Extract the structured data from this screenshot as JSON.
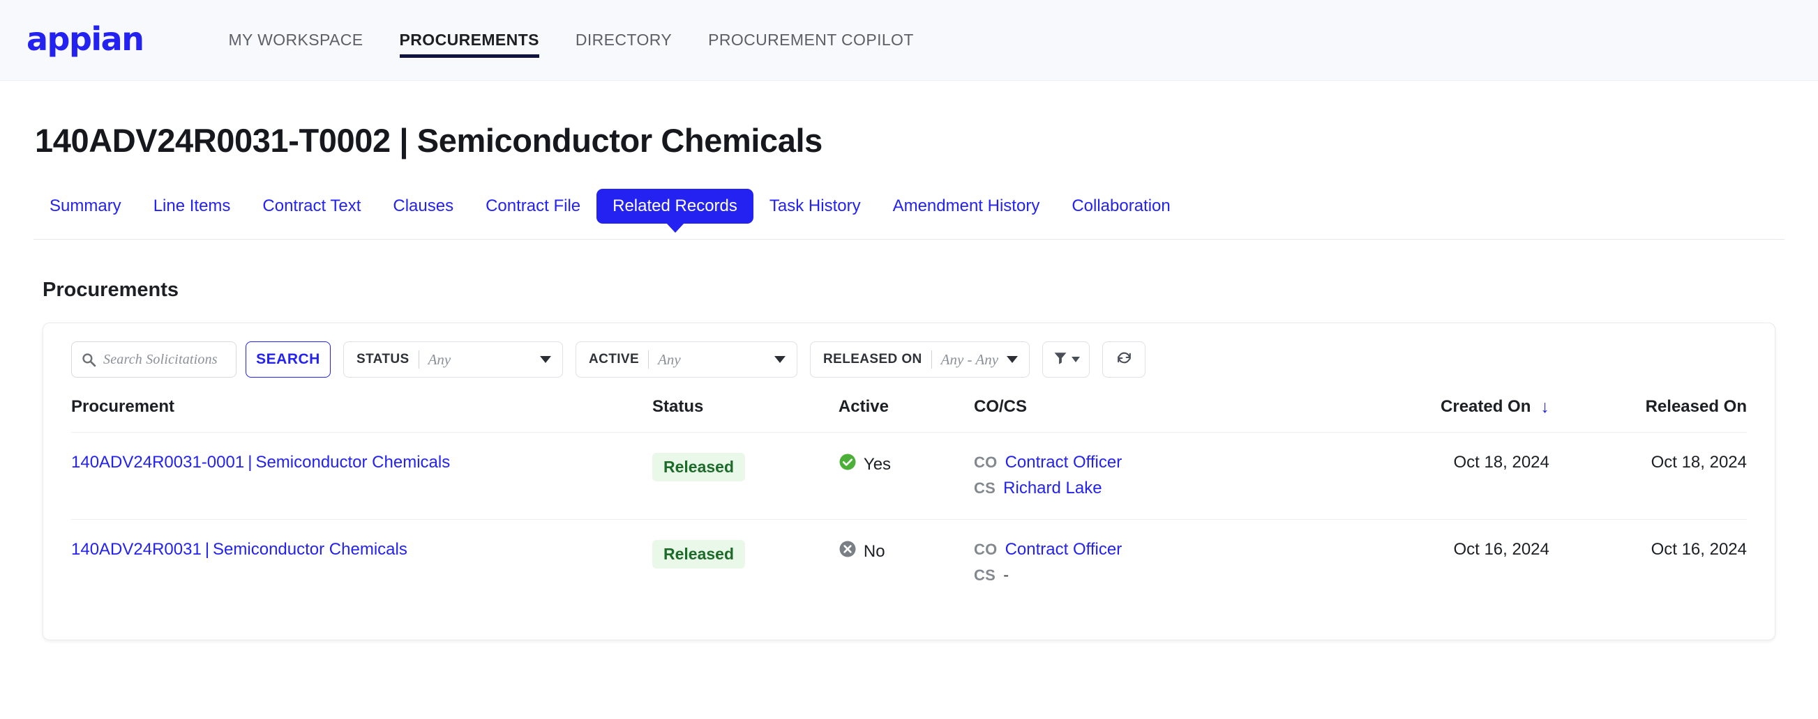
{
  "header": {
    "logo_text": "appian",
    "nav": [
      {
        "label": "MY WORKSPACE",
        "active": false
      },
      {
        "label": "PROCUREMENTS",
        "active": true
      },
      {
        "label": "DIRECTORY",
        "active": false
      },
      {
        "label": "PROCUREMENT COPILOT",
        "active": false
      }
    ]
  },
  "page": {
    "title": "140ADV24R0031-T0002 | Semiconductor Chemicals",
    "tabs": [
      {
        "label": "Summary",
        "active": false
      },
      {
        "label": "Line Items",
        "active": false
      },
      {
        "label": "Contract Text",
        "active": false
      },
      {
        "label": "Clauses",
        "active": false
      },
      {
        "label": "Contract File",
        "active": false
      },
      {
        "label": "Related Records",
        "active": true
      },
      {
        "label": "Task History",
        "active": false
      },
      {
        "label": "Amendment History",
        "active": false
      },
      {
        "label": "Collaboration",
        "active": false
      }
    ],
    "section_title": "Procurements"
  },
  "toolbar": {
    "search_placeholder": "Search Solicitations",
    "search_value": "",
    "search_button_label": "SEARCH",
    "filters": [
      {
        "name": "status",
        "label": "STATUS",
        "value": "Any"
      },
      {
        "name": "active",
        "label": "ACTIVE",
        "value": "Any"
      },
      {
        "name": "released_on",
        "label": "RELEASED ON",
        "value": "Any - Any"
      }
    ],
    "filter_icon_label": "filter-icon",
    "refresh_icon_label": "refresh-icon"
  },
  "table": {
    "columns": [
      {
        "key": "procurement",
        "label": "Procurement",
        "sorted": false
      },
      {
        "key": "status",
        "label": "Status",
        "sorted": false
      },
      {
        "key": "active",
        "label": "Active",
        "sorted": false
      },
      {
        "key": "cocs",
        "label": "CO/CS",
        "sorted": false
      },
      {
        "key": "created_on",
        "label": "Created On",
        "sorted": true,
        "sort_direction": "desc",
        "sort_glyph": "↓"
      },
      {
        "key": "released_on",
        "label": "Released On",
        "sorted": false
      }
    ],
    "rows": [
      {
        "procurement_id": "140ADV24R0031-0001",
        "procurement_separator": "|",
        "procurement_name": "Semiconductor Chemicals",
        "status": "Released",
        "active": "Yes",
        "active_state": "yes",
        "co_label": "CO",
        "co_value": "Contract Officer",
        "cs_label": "CS",
        "cs_value": "Richard Lake",
        "cs_is_link": true,
        "created_on": "Oct 18, 2024",
        "released_on": "Oct 18, 2024"
      },
      {
        "procurement_id": "140ADV24R0031",
        "procurement_separator": "|",
        "procurement_name": "Semiconductor Chemicals",
        "status": "Released",
        "active": "No",
        "active_state": "no",
        "co_label": "CO",
        "co_value": "Contract Officer",
        "cs_label": "CS",
        "cs_value": "-",
        "cs_is_link": false,
        "created_on": "Oct 16, 2024",
        "released_on": "Oct 16, 2024"
      }
    ]
  },
  "colors": {
    "brand_blue": "#2322f0",
    "nav_underline": "#101340",
    "header_bg": "#f8f9fc",
    "badge_bg": "#e9f8e9",
    "badge_text": "#1d6b29",
    "yes_green": "#4caf37",
    "no_gray": "#7a7f86"
  }
}
